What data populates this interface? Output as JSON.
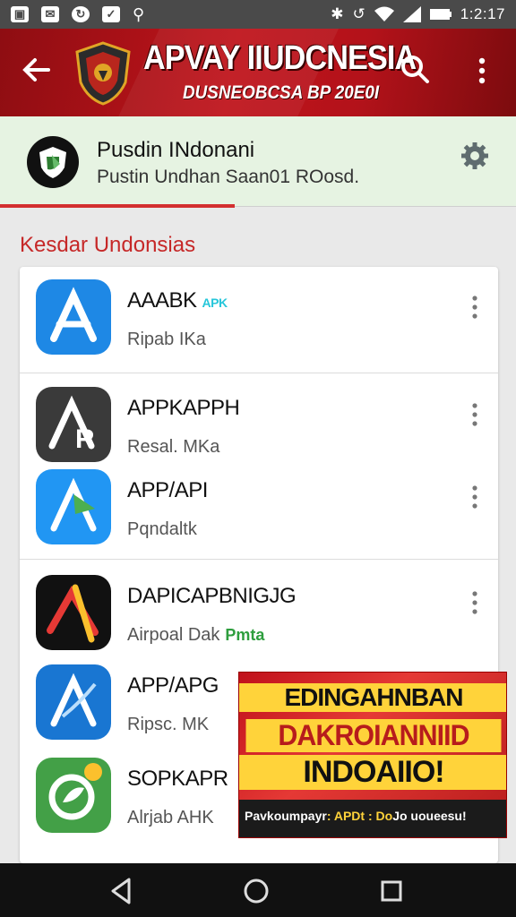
{
  "status_bar": {
    "time": "1:2:17",
    "icons": [
      "notification-icon",
      "email-icon",
      "sync-icon",
      "app-icon",
      "usb-icon",
      "bluetooth-icon",
      "wifi-icon",
      "signal-icon",
      "battery-icon"
    ]
  },
  "app_bar": {
    "title": "APVAY IIUDCNESIA",
    "subtitle": "DUSNEOBCSA BP 20E0I",
    "colors": {
      "bar": "#b3121a",
      "text": "#ffffff"
    }
  },
  "profile": {
    "name": "Pusdin INdonani",
    "subtitle": "Pustin Undhan Saan01 ROosd."
  },
  "section": {
    "title": "Kesdar Undonsias",
    "color": "#c62828"
  },
  "apps": [
    {
      "name": "AAABK",
      "tag": "APK",
      "sub": "Ripab IKa"
    },
    {
      "name": "APPKAPPH",
      "tag": "",
      "sub": "Resal. MKa"
    },
    {
      "name": "APP/API",
      "tag": "",
      "sub": "Pqndaltk"
    },
    {
      "name": "DAPICAPBNIGJG",
      "tag": "Pmta",
      "sub": "Airpoal Dak"
    },
    {
      "name": "APP/APG",
      "tag": "",
      "sub": "Ripsc. MK"
    },
    {
      "name": "SOPKAPR",
      "tag": "",
      "sub": "Alrjab AHK"
    }
  ],
  "banner": {
    "line1": "EDINGAHNBAN",
    "line2": "DAKROIANNIID",
    "line3": "INDOAIIO!",
    "footer_left": "Pavkoumpayr",
    "footer_accent": ": APDt : Do",
    "footer_right": "Jo uoueesu!"
  }
}
